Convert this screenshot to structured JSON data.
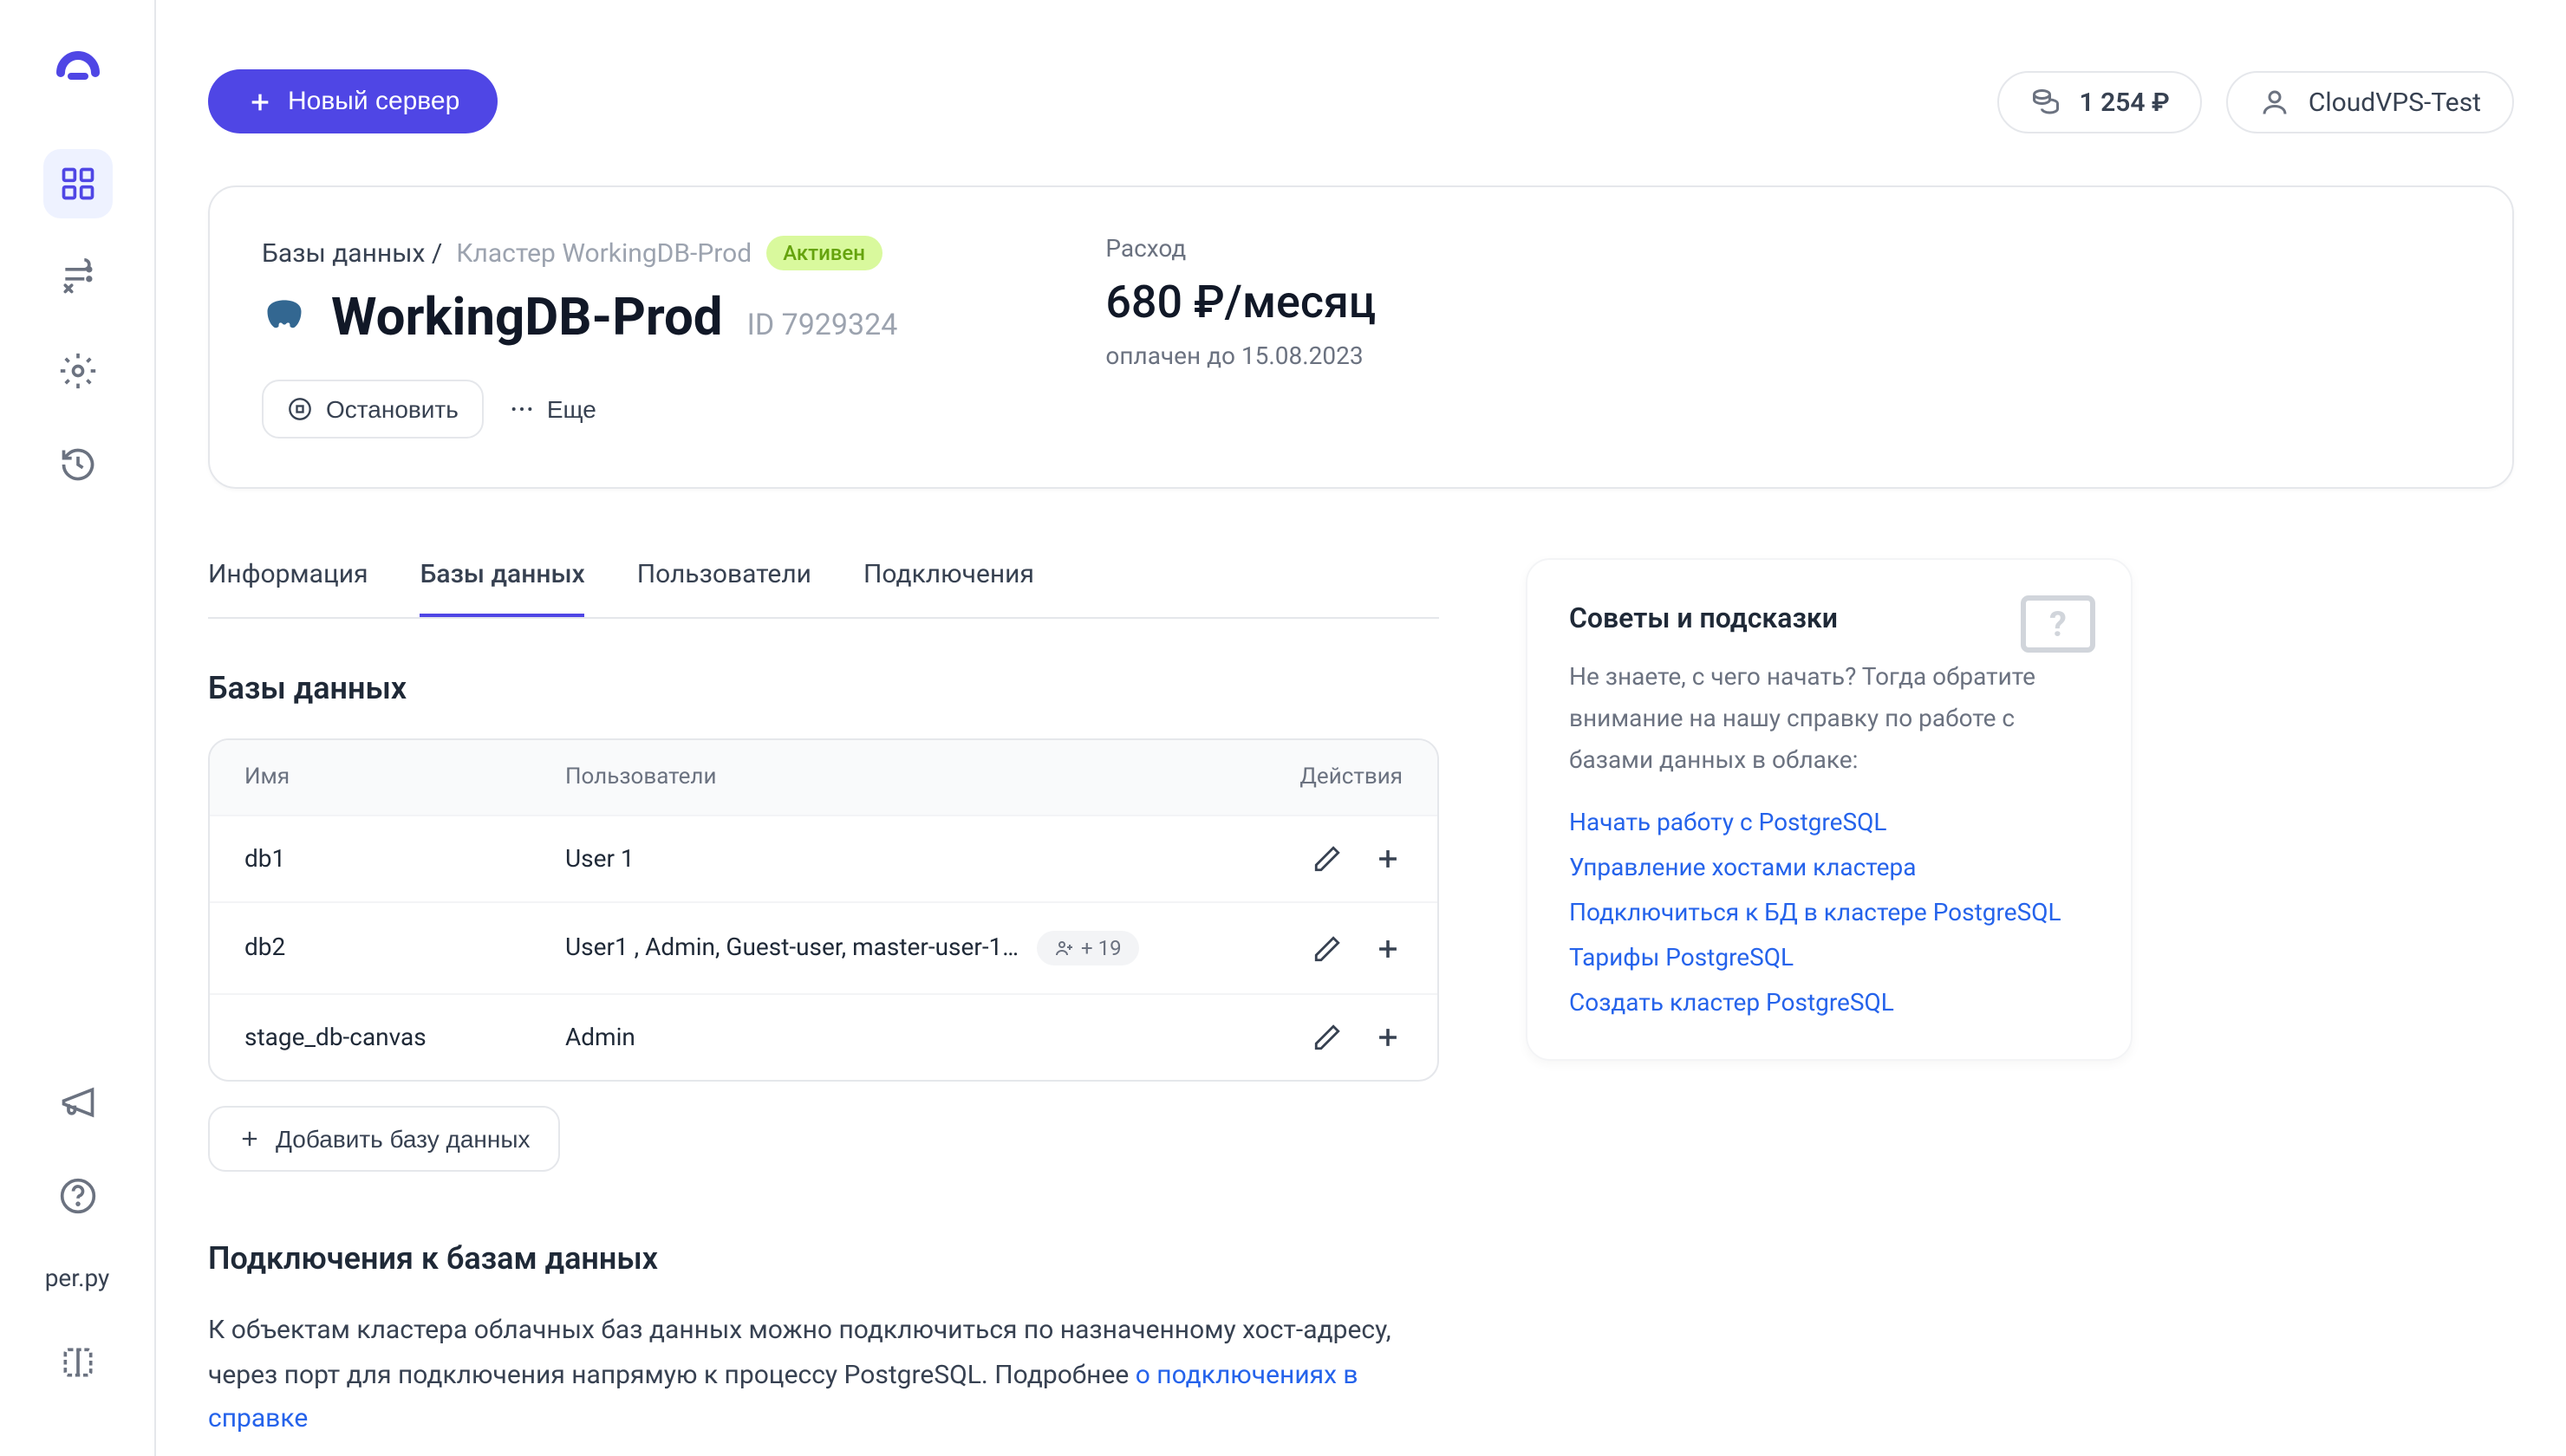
{
  "topbar": {
    "new_server": "Новый сервер",
    "balance": "1 254 ₽",
    "account": "CloudVPS-Test"
  },
  "sidebar": {
    "file_label": "per.py"
  },
  "cluster": {
    "bc_root": "Базы данных /",
    "bc_current": "Кластер WorkingDB-Prod",
    "status": "Активен",
    "name": "WorkingDB-Prod",
    "id": "ID 7929324",
    "stop": "Остановить",
    "more": "Еще",
    "expense_label": "Расход",
    "expense_amount": "680 ₽/месяц",
    "expense_until": "оплачен до 15.08.2023"
  },
  "tabs": {
    "t0": "Информация",
    "t1": "Базы данных",
    "t2": "Пользователи",
    "t3": "Подключения"
  },
  "db_section": {
    "title": "Базы данных",
    "col_name": "Имя",
    "col_users": "Пользователи",
    "col_actions": "Действия",
    "rows": [
      {
        "name": "db1",
        "users": "User 1"
      },
      {
        "name": "db2",
        "users": "User1 , Admin, Guest-user, master-user-1…",
        "more": "+ 19"
      },
      {
        "name": "stage_db-canvas",
        "users": "Admin"
      }
    ],
    "add": "Добавить базу данных"
  },
  "conn": {
    "title": "Подключения к базам данных",
    "text": "К объектам кластера облачных баз данных можно подключиться по назначенному хост-адресу, через порт для подключения напрямую к процессу PostgreSQL. Подробнее ",
    "link": "о подключениях в справке"
  },
  "tips": {
    "title": "Советы и подсказки",
    "text": "Не знаете, с чего начать? Тогда обратите внимание на нашу справку по работе с базами данных в облаке:",
    "links": [
      "Начать работу с PostgreSQL",
      "Управление хостами кластера",
      "Подключиться к БД в кластере PostgreSQL",
      "Тарифы PostgreSQL",
      "Создать кластер PostgreSQL"
    ]
  }
}
